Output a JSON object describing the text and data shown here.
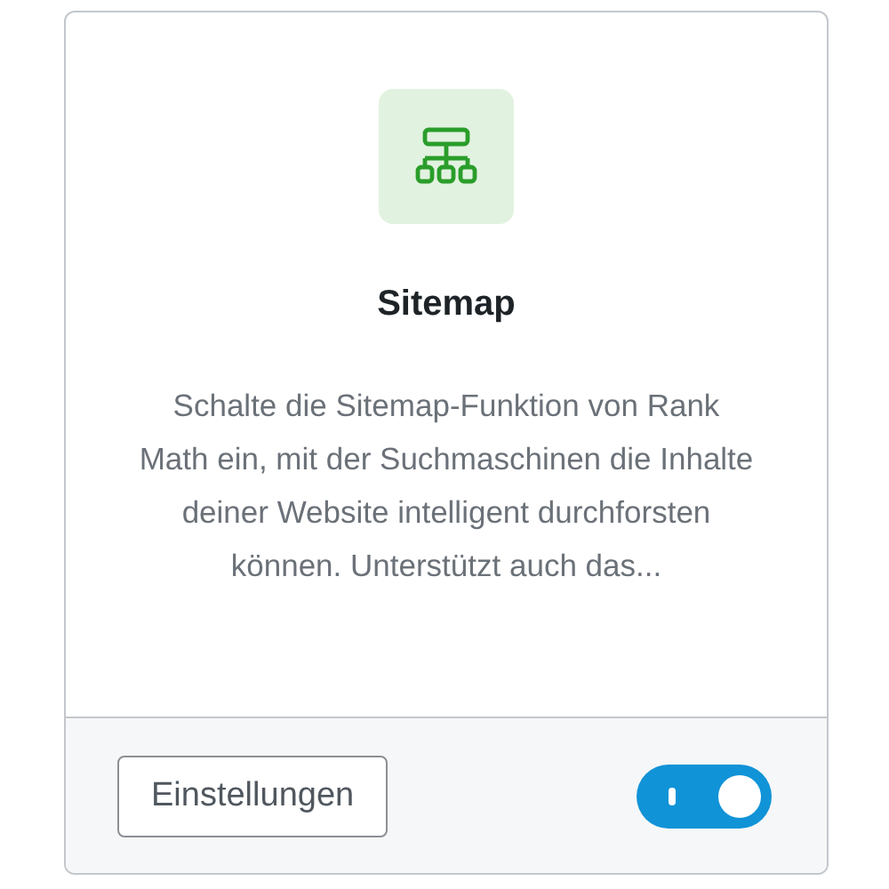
{
  "module": {
    "title": "Sitemap",
    "description": "Schalte die Sitemap-Funktion von Rank Math ein, mit der Suchmaschinen die Inhalte deiner Website intelligent durchforsten können. Unterstützt auch das...",
    "settings_button": "Einstellungen",
    "enabled": true
  }
}
